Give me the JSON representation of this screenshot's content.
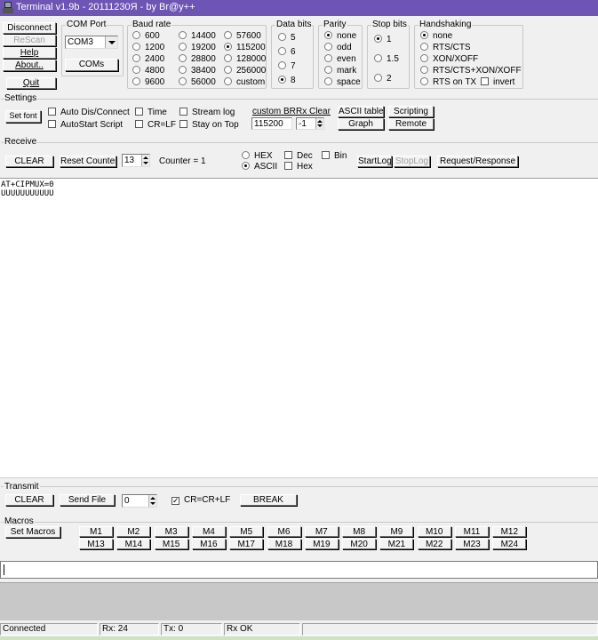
{
  "window": {
    "title": "Terminal v1.9b - 20111230Я - by Br@y++"
  },
  "left_buttons": {
    "disconnect": "Disconnect",
    "rescan": "ReScan",
    "help": "Help",
    "about": "About..",
    "quit": "Quit"
  },
  "com_port": {
    "label": "COM Port",
    "selected": "COM3",
    "coms_button": "COMs"
  },
  "baud_rate": {
    "label": "Baud rate",
    "options": [
      "600",
      "1200",
      "2400",
      "4800",
      "9600",
      "14400",
      "19200",
      "28800",
      "38400",
      "56000",
      "57600",
      "115200",
      "128000",
      "256000",
      "custom"
    ],
    "selected": "115200"
  },
  "data_bits": {
    "label": "Data bits",
    "options": [
      "5",
      "6",
      "7",
      "8"
    ],
    "selected": "8"
  },
  "parity": {
    "label": "Parity",
    "options": [
      "none",
      "odd",
      "even",
      "mark",
      "space"
    ],
    "selected": "none"
  },
  "stop_bits": {
    "label": "Stop bits",
    "options": [
      "1",
      "1.5",
      "2"
    ],
    "selected": "1"
  },
  "handshaking": {
    "label": "Handshaking",
    "options": [
      "none",
      "RTS/CTS",
      "XON/XOFF",
      "RTS/CTS+XON/XOFF",
      "RTS on TX"
    ],
    "selected": "none",
    "invert_label": "invert"
  },
  "settings": {
    "label": "Settings",
    "set_font": "Set font",
    "auto_dis_connect": "Auto Dis/Connect",
    "autostart_script": "AutoStart Script",
    "time": "Time",
    "cr_lf": "CR=LF",
    "stream_log": "Stream log",
    "stay_on_top": "Stay on Top",
    "custom_br_label": "custom BR",
    "custom_br_value": "115200",
    "rx_clear_label": "Rx Clear",
    "rx_clear_value": "-1",
    "ascii_table": "ASCII table",
    "graph": "Graph",
    "scripting": "Scripting",
    "remote": "Remote"
  },
  "receive": {
    "label": "Receive",
    "clear": "CLEAR",
    "reset_counter": "Reset Counter",
    "counter_spin": "13",
    "counter_label": "Counter = ",
    "counter_value": "1",
    "hex": "HEX",
    "ascii": "ASCII",
    "format_selected": "ASCII",
    "dec": "Dec",
    "hex_cb": "Hex",
    "bin": "Bin",
    "startlog": "StartLog",
    "stoplog": "StopLog",
    "request_response": "Request/Response",
    "lines": [
      "AT+CIPMUX=0",
      "UUUUUUUUUUU"
    ]
  },
  "transmit": {
    "label": "Transmit",
    "clear": "CLEAR",
    "send_file": "Send File",
    "spin_value": "0",
    "cr_crlf": "CR=CR+LF",
    "break": "BREAK"
  },
  "macros": {
    "label": "Macros",
    "set_macros": "Set Macros",
    "row1": [
      "M1",
      "M2",
      "M3",
      "M4",
      "M5",
      "M6",
      "M7",
      "M8",
      "M9",
      "M10",
      "M11",
      "M12"
    ],
    "row2": [
      "M13",
      "M14",
      "M15",
      "M16",
      "M17",
      "M18",
      "M19",
      "M20",
      "M21",
      "M22",
      "M23",
      "M24"
    ]
  },
  "status": {
    "connection": "Connected",
    "rx": "Rx: 24",
    "tx": "Tx: 0",
    "rx_ok": "Rx OK"
  }
}
